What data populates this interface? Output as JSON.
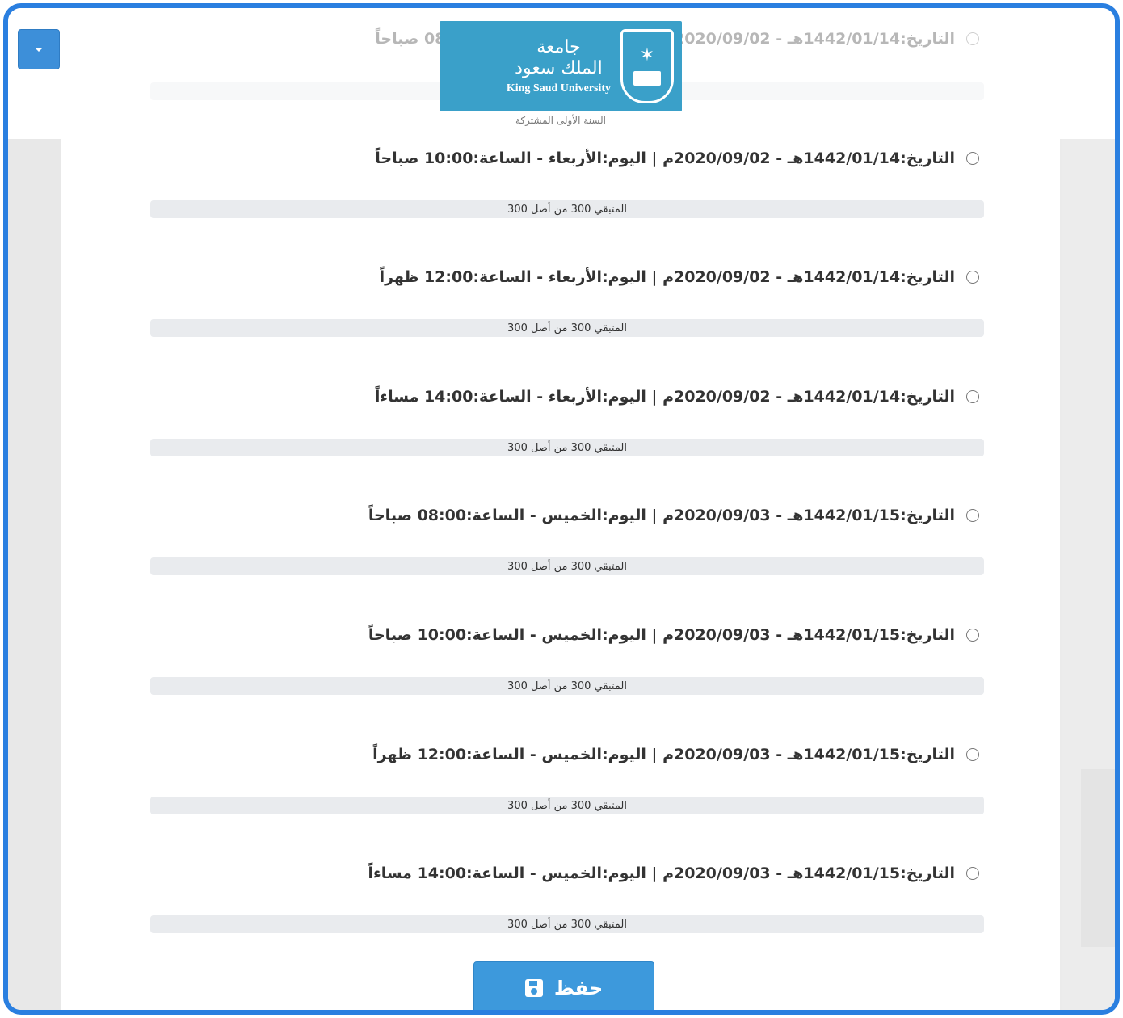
{
  "logo": {
    "arabic_line1": "جامعة",
    "arabic_line2": "الملك سعود",
    "english": "King Saud University",
    "subtitle": "السنة الأولى المشتركة"
  },
  "faded_option": {
    "label": "التاريخ:1442/01/14هـ - 2020/09/02م | اليوم:الأربعاء - الساعة:08:00 صباحاً"
  },
  "options": [
    {
      "label": "التاريخ:1442/01/14هـ - 2020/09/02م | اليوم:الأربعاء - الساعة:10:00 صباحاً",
      "remaining": "المتبقي 300 من أصل 300"
    },
    {
      "label": "التاريخ:1442/01/14هـ - 2020/09/02م | اليوم:الأربعاء - الساعة:12:00 ظهراً",
      "remaining": "المتبقي 300 من أصل 300"
    },
    {
      "label": "التاريخ:1442/01/14هـ - 2020/09/02م | اليوم:الأربعاء - الساعة:14:00 مساءاً",
      "remaining": "المتبقي 300 من أصل 300"
    },
    {
      "label": "التاريخ:1442/01/15هـ - 2020/09/03م | اليوم:الخميس - الساعة:08:00 صباحاً",
      "remaining": "المتبقي 300 من أصل 300"
    },
    {
      "label": "التاريخ:1442/01/15هـ - 2020/09/03م | اليوم:الخميس - الساعة:10:00 صباحاً",
      "remaining": "المتبقي 300 من أصل 300"
    },
    {
      "label": "التاريخ:1442/01/15هـ - 2020/09/03م | اليوم:الخميس - الساعة:12:00 ظهراً",
      "remaining": "المتبقي 300 من أصل 300"
    },
    {
      "label": "التاريخ:1442/01/15هـ - 2020/09/03م | اليوم:الخميس - الساعة:14:00 مساءاً",
      "remaining": "المتبقي 300 من أصل 300"
    }
  ],
  "save_button": {
    "label": "حفظ"
  },
  "icons": {
    "menu": "caret-down-icon",
    "save": "floppy-disk-icon",
    "radio": "radio-unchecked-icon"
  },
  "colors": {
    "accent": "#3d99dc",
    "frame": "#2a7fe0"
  }
}
